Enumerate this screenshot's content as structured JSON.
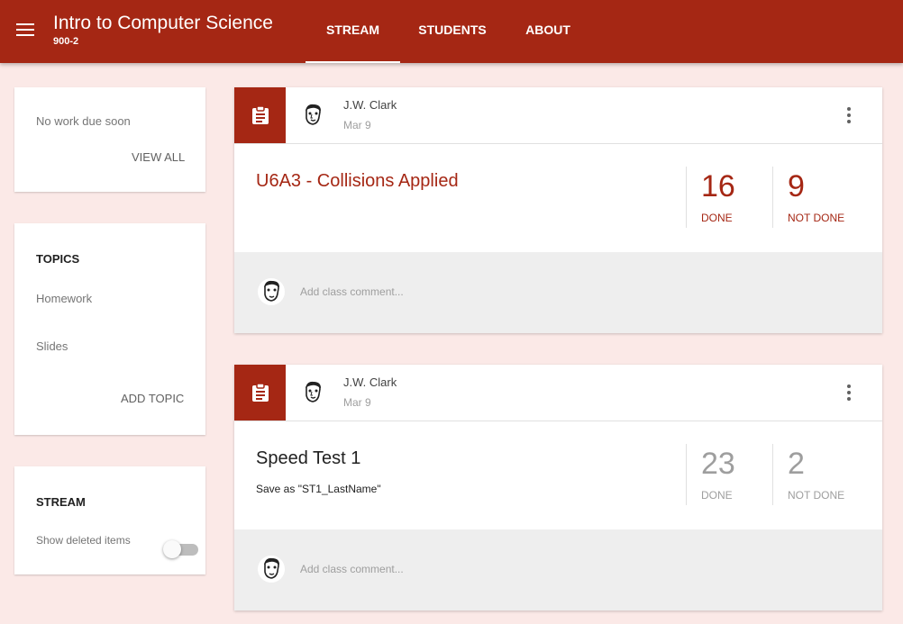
{
  "header": {
    "class_title": "Intro to Computer Science",
    "class_section": "900-2",
    "tabs": [
      {
        "label": "STREAM",
        "active": true
      },
      {
        "label": "STUDENTS",
        "active": false
      },
      {
        "label": "ABOUT",
        "active": false
      }
    ]
  },
  "upcoming": {
    "message": "No work due soon",
    "view_all": "VIEW ALL"
  },
  "topics": {
    "heading": "TOPICS",
    "items": [
      "Homework",
      "Slides"
    ],
    "add_topic": "ADD TOPIC"
  },
  "stream_settings": {
    "heading": "STREAM",
    "show_deleted_label": "Show deleted items",
    "show_deleted_on": false
  },
  "posts": [
    {
      "author": "J.W. Clark",
      "date": "Mar 9",
      "title": "U6A3 - Collisions Applied",
      "subtitle": "",
      "done_count": "16",
      "done_label": "DONE",
      "not_done_count": "9",
      "not_done_label": "NOT DONE",
      "comment_placeholder": "Add class comment..."
    },
    {
      "author": "J.W. Clark",
      "date": "Mar 9",
      "title": "Speed Test 1",
      "subtitle": "Save as \"ST1_LastName\"",
      "done_count": "23",
      "done_label": "DONE",
      "not_done_count": "2",
      "not_done_label": "NOT DONE",
      "comment_placeholder": "Add class comment..."
    }
  ],
  "colors": {
    "brand": "#a52714",
    "background": "#fbe9e7",
    "muted": "#9e9e9e"
  },
  "icons": {
    "menu": "hamburger-menu-icon",
    "assignment": "assignment-clipboard-icon",
    "more": "more-vertical-icon",
    "avatar": "teacher-avatar"
  }
}
